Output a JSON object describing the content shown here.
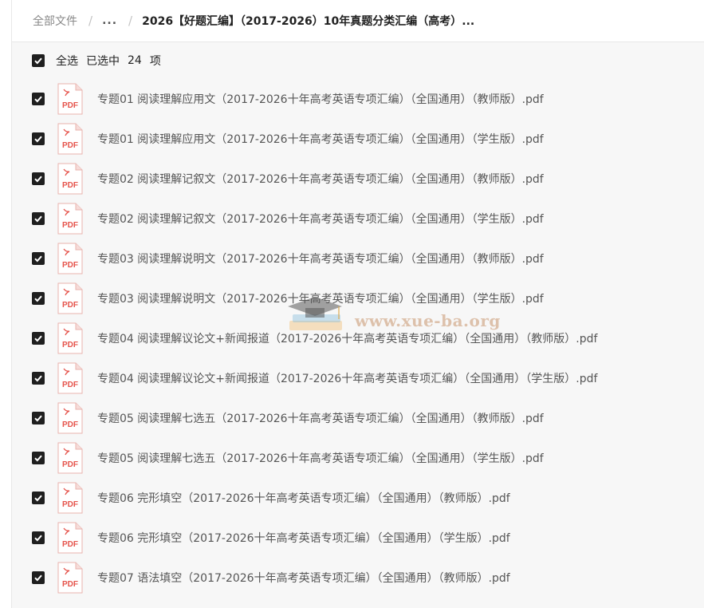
{
  "breadcrumb": {
    "root": "全部文件",
    "separator": "/",
    "ellipsis": "...",
    "current": "2026【好题汇编】（2017-2026）10年真题分类汇编（高考）..."
  },
  "selection": {
    "select_all_label": "全选",
    "selected_prefix": "已选中",
    "selected_count": "24",
    "selected_suffix": "项"
  },
  "file_icon": {
    "name": "pdf-file-icon",
    "text": "PDF",
    "color": "#e5534b"
  },
  "files": [
    {
      "name": "专题01 阅读理解应用文（2017-2026十年高考英语专项汇编）（全国通用）（教师版）.pdf",
      "checked": true
    },
    {
      "name": "专题01 阅读理解应用文（2017-2026十年高考英语专项汇编）（全国通用）（学生版）.pdf",
      "checked": true
    },
    {
      "name": "专题02 阅读理解记叙文（2017-2026十年高考英语专项汇编）（全国通用）（教师版）.pdf",
      "checked": true
    },
    {
      "name": "专题02 阅读理解记叙文（2017-2026十年高考英语专项汇编）（全国通用）（学生版）.pdf",
      "checked": true
    },
    {
      "name": "专题03 阅读理解说明文（2017-2026十年高考英语专项汇编）（全国通用）（教师版）.pdf",
      "checked": true
    },
    {
      "name": "专题03 阅读理解说明文（2017-2026十年高考英语专项汇编）（全国通用）（学生版）.pdf",
      "checked": true
    },
    {
      "name": "专题04 阅读理解议论文+新闻报道（2017-2026十年高考英语专项汇编）（全国通用）（教师版）.pdf",
      "checked": true
    },
    {
      "name": "专题04 阅读理解议论文+新闻报道（2017-2026十年高考英语专项汇编）（全国通用）（学生版）.pdf",
      "checked": true
    },
    {
      "name": "专题05 阅读理解七选五（2017-2026十年高考英语专项汇编）（全国通用）（教师版）.pdf",
      "checked": true
    },
    {
      "name": "专题05 阅读理解七选五（2017-2026十年高考英语专项汇编）（全国通用）（学生版）.pdf",
      "checked": true
    },
    {
      "name": "专题06 完形填空（2017-2026十年高考英语专项汇编）（全国通用）（教师版）.pdf",
      "checked": true
    },
    {
      "name": "专题06 完形填空（2017-2026十年高考英语专项汇编）（全国通用）（学生版）.pdf",
      "checked": true
    },
    {
      "name": "专题07 语法填空（2017-2026十年高考英语专项汇编）（全国通用）（教师版）.pdf",
      "checked": true
    }
  ],
  "watermark": {
    "text": "www.xue-ba.org"
  },
  "colors": {
    "checkbox": "#1f1f1f",
    "list_bg": "#f7f7f7",
    "pdf_red": "#e5534b"
  }
}
